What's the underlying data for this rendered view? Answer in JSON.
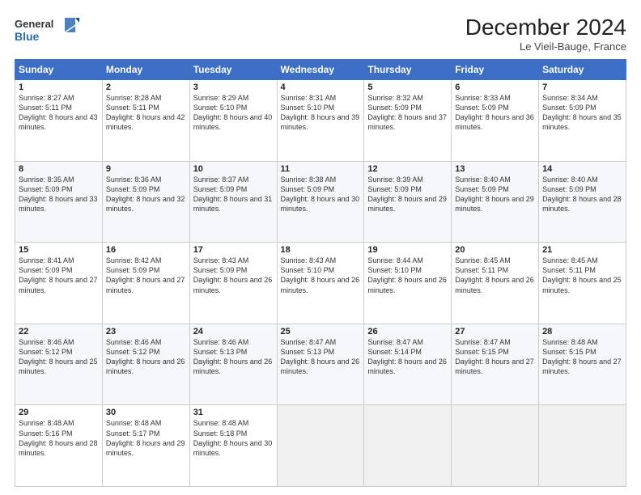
{
  "header": {
    "logo_line1": "General",
    "logo_line2": "Blue",
    "month": "December 2024",
    "location": "Le Vieil-Bauge, France"
  },
  "days_of_week": [
    "Sunday",
    "Monday",
    "Tuesday",
    "Wednesday",
    "Thursday",
    "Friday",
    "Saturday"
  ],
  "weeks": [
    [
      {
        "day": "1",
        "sunrise": "Sunrise: 8:27 AM",
        "sunset": "Sunset: 5:11 PM",
        "daylight": "Daylight: 8 hours and 43 minutes."
      },
      {
        "day": "2",
        "sunrise": "Sunrise: 8:28 AM",
        "sunset": "Sunset: 5:11 PM",
        "daylight": "Daylight: 8 hours and 42 minutes."
      },
      {
        "day": "3",
        "sunrise": "Sunrise: 8:29 AM",
        "sunset": "Sunset: 5:10 PM",
        "daylight": "Daylight: 8 hours and 40 minutes."
      },
      {
        "day": "4",
        "sunrise": "Sunrise: 8:31 AM",
        "sunset": "Sunset: 5:10 PM",
        "daylight": "Daylight: 8 hours and 39 minutes."
      },
      {
        "day": "5",
        "sunrise": "Sunrise: 8:32 AM",
        "sunset": "Sunset: 5:09 PM",
        "daylight": "Daylight: 8 hours and 37 minutes."
      },
      {
        "day": "6",
        "sunrise": "Sunrise: 8:33 AM",
        "sunset": "Sunset: 5:09 PM",
        "daylight": "Daylight: 8 hours and 36 minutes."
      },
      {
        "day": "7",
        "sunrise": "Sunrise: 8:34 AM",
        "sunset": "Sunset: 5:09 PM",
        "daylight": "Daylight: 8 hours and 35 minutes."
      }
    ],
    [
      {
        "day": "8",
        "sunrise": "Sunrise: 8:35 AM",
        "sunset": "Sunset: 5:09 PM",
        "daylight": "Daylight: 8 hours and 33 minutes."
      },
      {
        "day": "9",
        "sunrise": "Sunrise: 8:36 AM",
        "sunset": "Sunset: 5:09 PM",
        "daylight": "Daylight: 8 hours and 32 minutes."
      },
      {
        "day": "10",
        "sunrise": "Sunrise: 8:37 AM",
        "sunset": "Sunset: 5:09 PM",
        "daylight": "Daylight: 8 hours and 31 minutes."
      },
      {
        "day": "11",
        "sunrise": "Sunrise: 8:38 AM",
        "sunset": "Sunset: 5:09 PM",
        "daylight": "Daylight: 8 hours and 30 minutes."
      },
      {
        "day": "12",
        "sunrise": "Sunrise: 8:39 AM",
        "sunset": "Sunset: 5:09 PM",
        "daylight": "Daylight: 8 hours and 29 minutes."
      },
      {
        "day": "13",
        "sunrise": "Sunrise: 8:40 AM",
        "sunset": "Sunset: 5:09 PM",
        "daylight": "Daylight: 8 hours and 29 minutes."
      },
      {
        "day": "14",
        "sunrise": "Sunrise: 8:40 AM",
        "sunset": "Sunset: 5:09 PM",
        "daylight": "Daylight: 8 hours and 28 minutes."
      }
    ],
    [
      {
        "day": "15",
        "sunrise": "Sunrise: 8:41 AM",
        "sunset": "Sunset: 5:09 PM",
        "daylight": "Daylight: 8 hours and 27 minutes."
      },
      {
        "day": "16",
        "sunrise": "Sunrise: 8:42 AM",
        "sunset": "Sunset: 5:09 PM",
        "daylight": "Daylight: 8 hours and 27 minutes."
      },
      {
        "day": "17",
        "sunrise": "Sunrise: 8:43 AM",
        "sunset": "Sunset: 5:09 PM",
        "daylight": "Daylight: 8 hours and 26 minutes."
      },
      {
        "day": "18",
        "sunrise": "Sunrise: 8:43 AM",
        "sunset": "Sunset: 5:10 PM",
        "daylight": "Daylight: 8 hours and 26 minutes."
      },
      {
        "day": "19",
        "sunrise": "Sunrise: 8:44 AM",
        "sunset": "Sunset: 5:10 PM",
        "daylight": "Daylight: 8 hours and 26 minutes."
      },
      {
        "day": "20",
        "sunrise": "Sunrise: 8:45 AM",
        "sunset": "Sunset: 5:11 PM",
        "daylight": "Daylight: 8 hours and 26 minutes."
      },
      {
        "day": "21",
        "sunrise": "Sunrise: 8:45 AM",
        "sunset": "Sunset: 5:11 PM",
        "daylight": "Daylight: 8 hours and 25 minutes."
      }
    ],
    [
      {
        "day": "22",
        "sunrise": "Sunrise: 8:46 AM",
        "sunset": "Sunset: 5:12 PM",
        "daylight": "Daylight: 8 hours and 25 minutes."
      },
      {
        "day": "23",
        "sunrise": "Sunrise: 8:46 AM",
        "sunset": "Sunset: 5:12 PM",
        "daylight": "Daylight: 8 hours and 26 minutes."
      },
      {
        "day": "24",
        "sunrise": "Sunrise: 8:46 AM",
        "sunset": "Sunset: 5:13 PM",
        "daylight": "Daylight: 8 hours and 26 minutes."
      },
      {
        "day": "25",
        "sunrise": "Sunrise: 8:47 AM",
        "sunset": "Sunset: 5:13 PM",
        "daylight": "Daylight: 8 hours and 26 minutes."
      },
      {
        "day": "26",
        "sunrise": "Sunrise: 8:47 AM",
        "sunset": "Sunset: 5:14 PM",
        "daylight": "Daylight: 8 hours and 26 minutes."
      },
      {
        "day": "27",
        "sunrise": "Sunrise: 8:47 AM",
        "sunset": "Sunset: 5:15 PM",
        "daylight": "Daylight: 8 hours and 27 minutes."
      },
      {
        "day": "28",
        "sunrise": "Sunrise: 8:48 AM",
        "sunset": "Sunset: 5:15 PM",
        "daylight": "Daylight: 8 hours and 27 minutes."
      }
    ],
    [
      {
        "day": "29",
        "sunrise": "Sunrise: 8:48 AM",
        "sunset": "Sunset: 5:16 PM",
        "daylight": "Daylight: 8 hours and 28 minutes."
      },
      {
        "day": "30",
        "sunrise": "Sunrise: 8:48 AM",
        "sunset": "Sunset: 5:17 PM",
        "daylight": "Daylight: 8 hours and 29 minutes."
      },
      {
        "day": "31",
        "sunrise": "Sunrise: 8:48 AM",
        "sunset": "Sunset: 5:18 PM",
        "daylight": "Daylight: 8 hours and 30 minutes."
      },
      null,
      null,
      null,
      null
    ]
  ]
}
